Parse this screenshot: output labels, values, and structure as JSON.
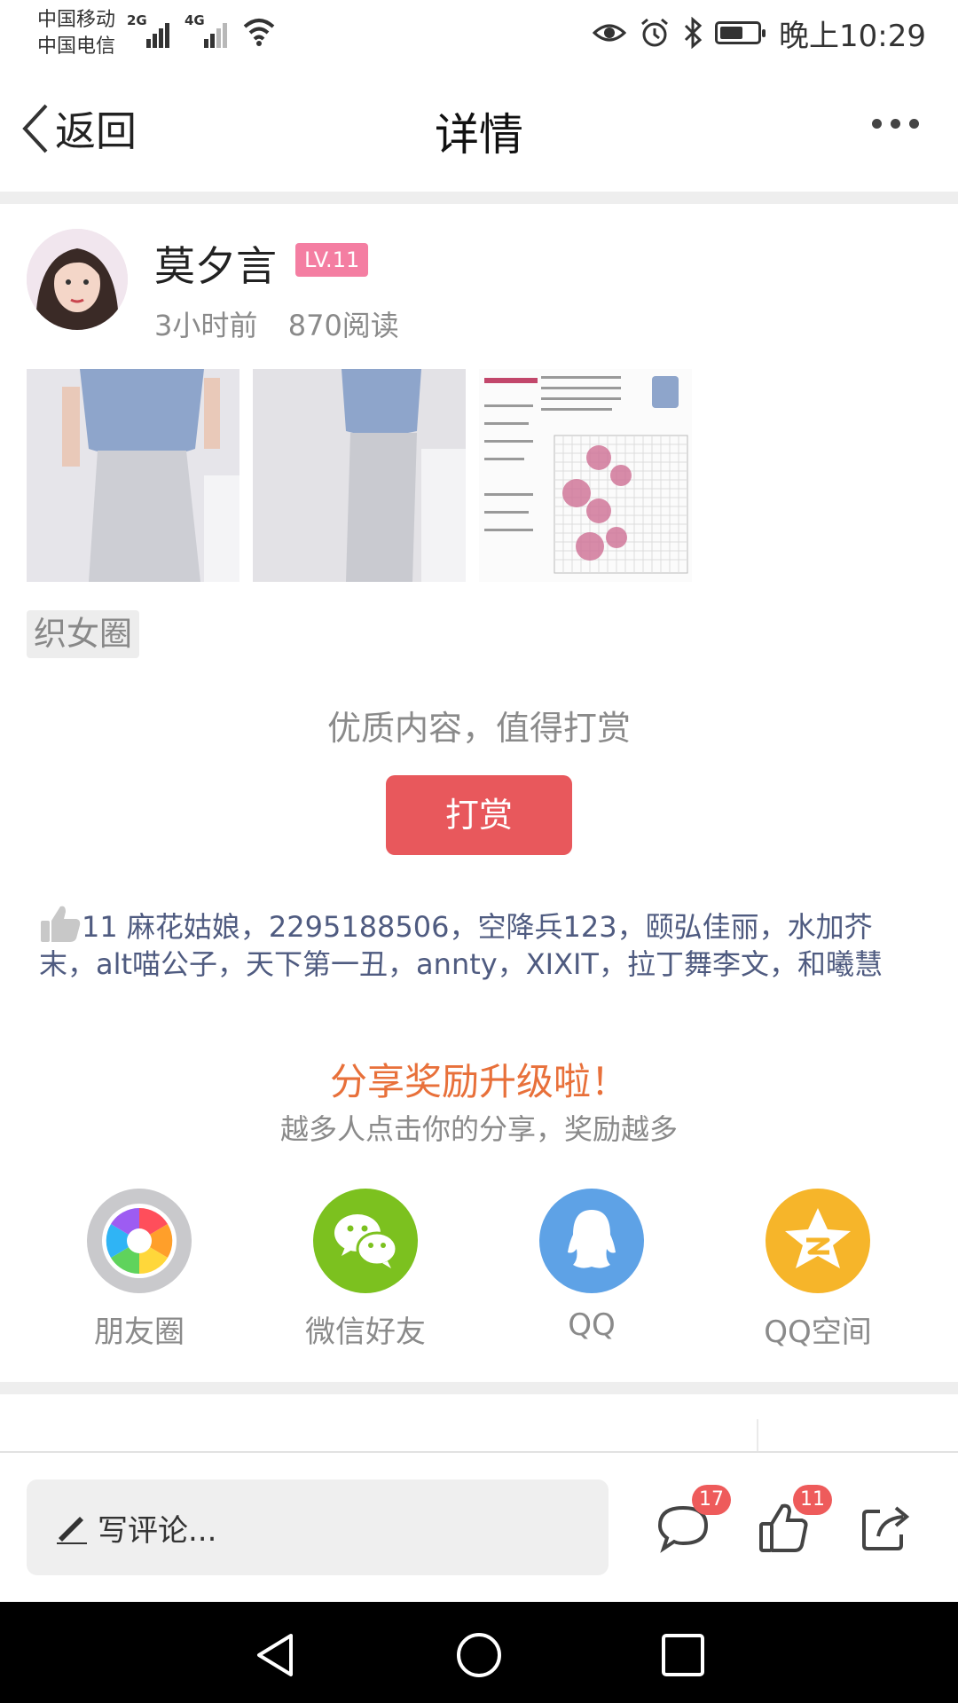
{
  "status_bar": {
    "carrier1": "中国移动",
    "carrier2": "中国电信",
    "net1": "2G",
    "net2": "4G",
    "battery_level": 0.55,
    "time": "晚上10:29",
    "icons": [
      "eye-icon",
      "alarm-icon",
      "bluetooth-icon",
      "battery-icon"
    ]
  },
  "nav": {
    "back_label": "返回",
    "title": "详情"
  },
  "author": {
    "name": "莫夕言",
    "level": "LV.11",
    "time_ago": "3小时前",
    "reads": "870阅读"
  },
  "tag": "织女圈",
  "reward": {
    "prompt": "优质内容，值得打赏",
    "button": "打赏"
  },
  "likes": {
    "count": "11",
    "names": "麻花姑娘，2295188506，空降兵123，颐弘佳丽，水加芥末，alt喵公子，天下第一丑，annty，XIXIT，拉丁舞李文，和曦慧"
  },
  "share": {
    "title": "分享奖励升级啦！",
    "subtitle": "越多人点击你的分享，奖励越多",
    "items": [
      {
        "label": "朋友圈",
        "icon": "moments-icon"
      },
      {
        "label": "微信好友",
        "icon": "wechat-icon"
      },
      {
        "label": "QQ",
        "icon": "qq-icon"
      },
      {
        "label": "QQ空间",
        "icon": "qzone-icon"
      }
    ]
  },
  "bottom": {
    "comment_placeholder": "写评论...",
    "comment_count": "17",
    "like_count": "11"
  },
  "colors": {
    "accent_red": "#e8585c",
    "level_pink": "#f47ea2",
    "share_orange": "#e8703a",
    "link_blue": "#4f5b80",
    "wechat_green": "#7cc11f",
    "qq_blue": "#5ea2e6",
    "qzone_yellow": "#f6b52a"
  }
}
